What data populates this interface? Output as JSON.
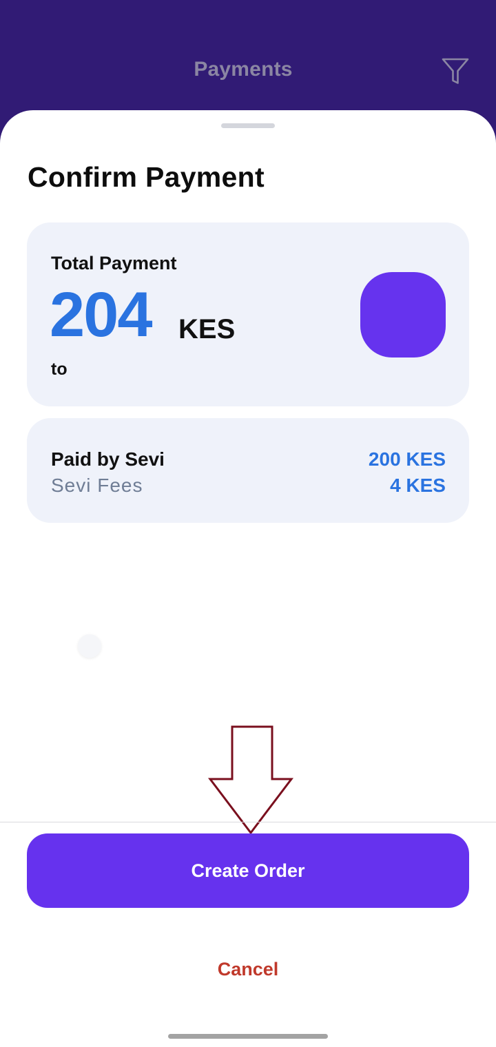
{
  "header": {
    "title": "Payments",
    "filter_icon": "filter-icon"
  },
  "sheet": {
    "title": "Confirm Payment"
  },
  "total_card": {
    "label": "Total Payment",
    "amount": "204",
    "currency": "KES",
    "to_label": "to",
    "avatar_color": "#6633EE"
  },
  "breakdown": {
    "rows": [
      {
        "label": "Paid by Sevi",
        "value": "200 KES"
      },
      {
        "label": "Sevi Fees",
        "value": "4 KES"
      }
    ]
  },
  "actions": {
    "create_order_label": "Create Order",
    "cancel_label": "Cancel"
  },
  "colors": {
    "header_bg": "#311B75",
    "primary_button": "#6632EE",
    "amount_blue": "#2A73E0",
    "cancel_red": "#C0392B",
    "annotation_arrow": "#7A0F1E"
  }
}
